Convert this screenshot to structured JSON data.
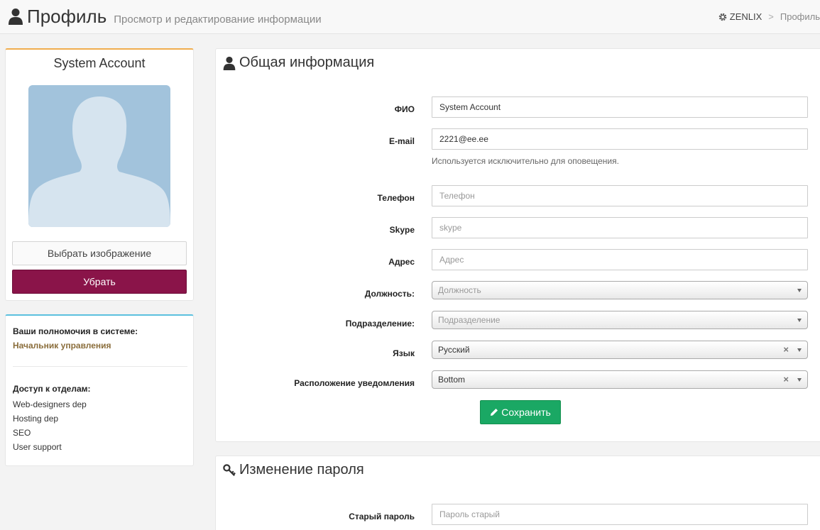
{
  "header": {
    "title": "Профиль",
    "subtitle": "Просмотр и редактирование информации",
    "breadcrumb": {
      "home": "ZENLIX",
      "separator": ">",
      "current": "Профиль"
    }
  },
  "profile": {
    "name": "System Account",
    "choose_image_label": "Выбрать изображение",
    "remove_label": "Убрать"
  },
  "permissions": {
    "label": "Ваши полномочия в системе:",
    "role": "Начальник управления",
    "departments_label": "Доступ к отделам:",
    "departments": [
      "Web-designers dep",
      "Hosting dep",
      "SEO",
      "User support"
    ]
  },
  "general": {
    "title": "Общая информация",
    "fio": {
      "label": "ФИО",
      "value": "System Account"
    },
    "email": {
      "label": "E-mail",
      "value": "2221@ee.ee",
      "help": "Используется исключительно для оповещения."
    },
    "phone": {
      "label": "Телефон",
      "placeholder": "Телефон"
    },
    "skype": {
      "label": "Skype",
      "placeholder": "skype"
    },
    "address": {
      "label": "Адрес",
      "placeholder": "Адрес"
    },
    "position": {
      "label": "Должность:",
      "placeholder": "Должность"
    },
    "department": {
      "label": "Подразделение:",
      "placeholder": "Подразделение"
    },
    "language": {
      "label": "Язык",
      "value": "Русский"
    },
    "notify": {
      "label": "Расположение уведомления",
      "value": "Bottom"
    },
    "save_label": "Сохранить"
  },
  "password": {
    "title": "Изменение пароля",
    "old": {
      "label": "Старый пароль",
      "placeholder": "Пароль старый"
    }
  },
  "colors": {
    "remove_button": "#8a1449",
    "save_button": "#1aa864",
    "profile_card_accent": "#f0ad4e",
    "permissions_card_accent": "#5bc0de",
    "role_text": "#8a6d3b"
  }
}
